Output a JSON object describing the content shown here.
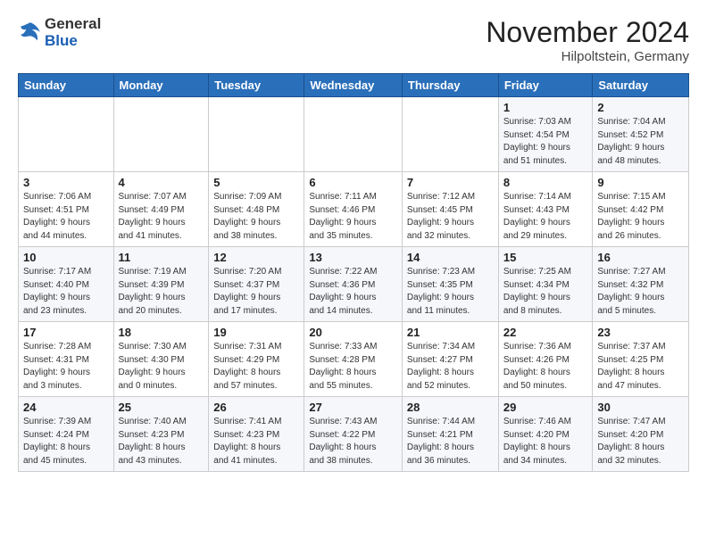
{
  "logo": {
    "general": "General",
    "blue": "Blue"
  },
  "header": {
    "month": "November 2024",
    "location": "Hilpoltstein, Germany"
  },
  "weekdays": [
    "Sunday",
    "Monday",
    "Tuesday",
    "Wednesday",
    "Thursday",
    "Friday",
    "Saturday"
  ],
  "weeks": [
    [
      {
        "day": "",
        "info": ""
      },
      {
        "day": "",
        "info": ""
      },
      {
        "day": "",
        "info": ""
      },
      {
        "day": "",
        "info": ""
      },
      {
        "day": "",
        "info": ""
      },
      {
        "day": "1",
        "info": "Sunrise: 7:03 AM\nSunset: 4:54 PM\nDaylight: 9 hours\nand 51 minutes."
      },
      {
        "day": "2",
        "info": "Sunrise: 7:04 AM\nSunset: 4:52 PM\nDaylight: 9 hours\nand 48 minutes."
      }
    ],
    [
      {
        "day": "3",
        "info": "Sunrise: 7:06 AM\nSunset: 4:51 PM\nDaylight: 9 hours\nand 44 minutes."
      },
      {
        "day": "4",
        "info": "Sunrise: 7:07 AM\nSunset: 4:49 PM\nDaylight: 9 hours\nand 41 minutes."
      },
      {
        "day": "5",
        "info": "Sunrise: 7:09 AM\nSunset: 4:48 PM\nDaylight: 9 hours\nand 38 minutes."
      },
      {
        "day": "6",
        "info": "Sunrise: 7:11 AM\nSunset: 4:46 PM\nDaylight: 9 hours\nand 35 minutes."
      },
      {
        "day": "7",
        "info": "Sunrise: 7:12 AM\nSunset: 4:45 PM\nDaylight: 9 hours\nand 32 minutes."
      },
      {
        "day": "8",
        "info": "Sunrise: 7:14 AM\nSunset: 4:43 PM\nDaylight: 9 hours\nand 29 minutes."
      },
      {
        "day": "9",
        "info": "Sunrise: 7:15 AM\nSunset: 4:42 PM\nDaylight: 9 hours\nand 26 minutes."
      }
    ],
    [
      {
        "day": "10",
        "info": "Sunrise: 7:17 AM\nSunset: 4:40 PM\nDaylight: 9 hours\nand 23 minutes."
      },
      {
        "day": "11",
        "info": "Sunrise: 7:19 AM\nSunset: 4:39 PM\nDaylight: 9 hours\nand 20 minutes."
      },
      {
        "day": "12",
        "info": "Sunrise: 7:20 AM\nSunset: 4:37 PM\nDaylight: 9 hours\nand 17 minutes."
      },
      {
        "day": "13",
        "info": "Sunrise: 7:22 AM\nSunset: 4:36 PM\nDaylight: 9 hours\nand 14 minutes."
      },
      {
        "day": "14",
        "info": "Sunrise: 7:23 AM\nSunset: 4:35 PM\nDaylight: 9 hours\nand 11 minutes."
      },
      {
        "day": "15",
        "info": "Sunrise: 7:25 AM\nSunset: 4:34 PM\nDaylight: 9 hours\nand 8 minutes."
      },
      {
        "day": "16",
        "info": "Sunrise: 7:27 AM\nSunset: 4:32 PM\nDaylight: 9 hours\nand 5 minutes."
      }
    ],
    [
      {
        "day": "17",
        "info": "Sunrise: 7:28 AM\nSunset: 4:31 PM\nDaylight: 9 hours\nand 3 minutes."
      },
      {
        "day": "18",
        "info": "Sunrise: 7:30 AM\nSunset: 4:30 PM\nDaylight: 9 hours\nand 0 minutes."
      },
      {
        "day": "19",
        "info": "Sunrise: 7:31 AM\nSunset: 4:29 PM\nDaylight: 8 hours\nand 57 minutes."
      },
      {
        "day": "20",
        "info": "Sunrise: 7:33 AM\nSunset: 4:28 PM\nDaylight: 8 hours\nand 55 minutes."
      },
      {
        "day": "21",
        "info": "Sunrise: 7:34 AM\nSunset: 4:27 PM\nDaylight: 8 hours\nand 52 minutes."
      },
      {
        "day": "22",
        "info": "Sunrise: 7:36 AM\nSunset: 4:26 PM\nDaylight: 8 hours\nand 50 minutes."
      },
      {
        "day": "23",
        "info": "Sunrise: 7:37 AM\nSunset: 4:25 PM\nDaylight: 8 hours\nand 47 minutes."
      }
    ],
    [
      {
        "day": "24",
        "info": "Sunrise: 7:39 AM\nSunset: 4:24 PM\nDaylight: 8 hours\nand 45 minutes."
      },
      {
        "day": "25",
        "info": "Sunrise: 7:40 AM\nSunset: 4:23 PM\nDaylight: 8 hours\nand 43 minutes."
      },
      {
        "day": "26",
        "info": "Sunrise: 7:41 AM\nSunset: 4:23 PM\nDaylight: 8 hours\nand 41 minutes."
      },
      {
        "day": "27",
        "info": "Sunrise: 7:43 AM\nSunset: 4:22 PM\nDaylight: 8 hours\nand 38 minutes."
      },
      {
        "day": "28",
        "info": "Sunrise: 7:44 AM\nSunset: 4:21 PM\nDaylight: 8 hours\nand 36 minutes."
      },
      {
        "day": "29",
        "info": "Sunrise: 7:46 AM\nSunset: 4:20 PM\nDaylight: 8 hours\nand 34 minutes."
      },
      {
        "day": "30",
        "info": "Sunrise: 7:47 AM\nSunset: 4:20 PM\nDaylight: 8 hours\nand 32 minutes."
      }
    ]
  ]
}
